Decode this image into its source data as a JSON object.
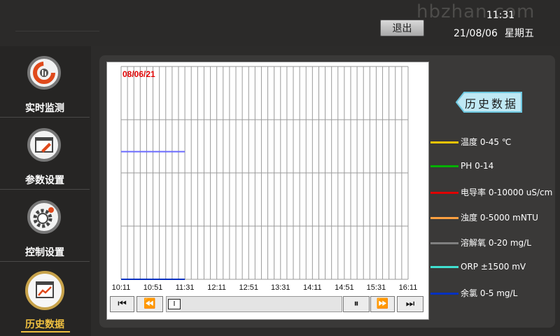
{
  "header": {
    "watermark": "hbzhan.com",
    "exit_label": "退出",
    "time": "11:31",
    "date": "21/08/06",
    "weekday": "星期五"
  },
  "sidebar": {
    "items": [
      {
        "label": "实时监测",
        "icon": "realtime-monitor-icon",
        "active": false
      },
      {
        "label": "参数设置",
        "icon": "settings-wrench-icon",
        "active": false
      },
      {
        "label": "控制设置",
        "icon": "control-gear-icon",
        "active": false
      },
      {
        "label": "历史数据",
        "icon": "history-chart-icon",
        "active": true
      }
    ]
  },
  "chart": {
    "date_label": "08/06/21",
    "x_ticks": [
      "10:11",
      "10:51",
      "11:31",
      "12:11",
      "12:51",
      "13:31",
      "14:11",
      "14:51",
      "15:31",
      "16:11"
    ],
    "history_tag": "历史数据",
    "controls": {
      "first": "⏮",
      "rewind": "⏪",
      "pause": "⏸",
      "forward": "⏩",
      "last": "⏭"
    }
  },
  "legend": [
    {
      "label": "温度 0-45 ℃",
      "color": "#f2c400"
    },
    {
      "label": "PH 0-14",
      "color": "#00b000"
    },
    {
      "label": "电导率 0-10000 uS/cm",
      "color": "#e00000"
    },
    {
      "label": "浊度 0-5000 mNTU",
      "color": "#ffa040"
    },
    {
      "label": "溶解氧 0-20 mg/L",
      "color": "#808080"
    },
    {
      "label": "ORP ±1500 mV",
      "color": "#40e0d0"
    },
    {
      "label": "余氯 0-5 mg/L",
      "color": "#0030c0"
    }
  ],
  "chart_data": {
    "type": "line",
    "x": [
      "10:11",
      "10:51",
      "11:31",
      "12:11",
      "12:51",
      "13:31",
      "14:11",
      "14:51",
      "15:31",
      "16:11"
    ],
    "series": [
      {
        "name": "余氯 0-5 mg/L",
        "color": "#0030c0",
        "x": [
          "10:11",
          "11:31"
        ],
        "values": [
          0,
          0
        ]
      },
      {
        "name": "溶解氧 0-20 mg/L",
        "color": "#6a6aff",
        "x": [
          "10:11",
          "11:31"
        ],
        "values": [
          0.6,
          0.6
        ]
      }
    ],
    "ylim": [
      0,
      1
    ],
    "grid": true
  }
}
